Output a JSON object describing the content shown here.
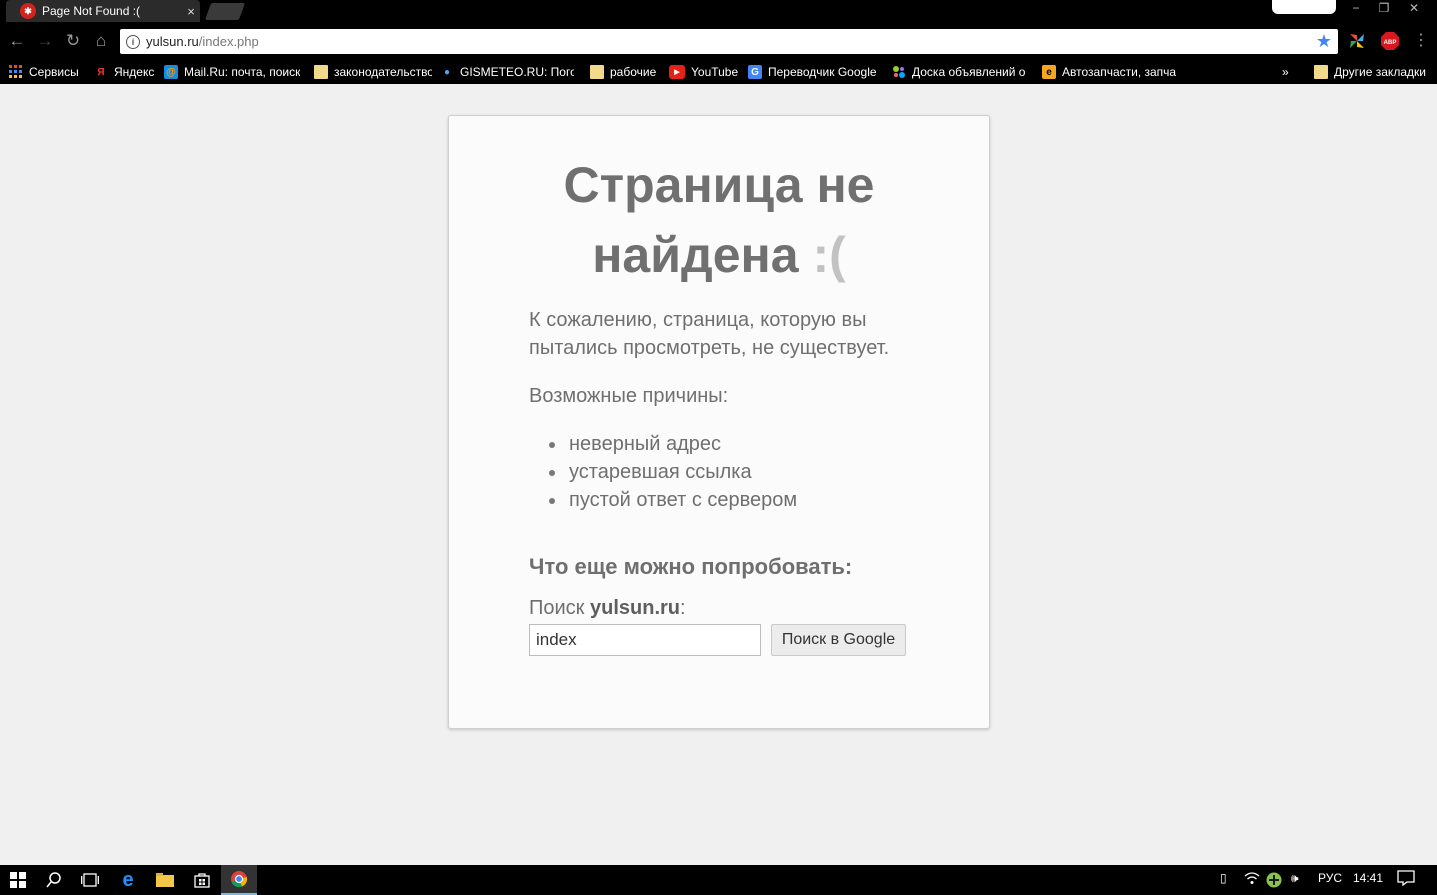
{
  "browser": {
    "tab_title": "Page Not Found :(",
    "tab_close": "×",
    "url_host": "yulsun.ru",
    "url_path": "/index.php",
    "accent": "#4285f4",
    "window_controls": [
      "−",
      "❐",
      "✕"
    ]
  },
  "bookmarks": {
    "items": [
      {
        "label": "Сервисы",
        "icon": "apps-grid-icon"
      },
      {
        "label": "Яндекс",
        "icon": "yandex-icon"
      },
      {
        "label": "Mail.Ru: почта, поиск",
        "icon": "mailru-icon"
      },
      {
        "label": "законодательство",
        "icon": "folder-icon"
      },
      {
        "label": "GISMETEO.RU: Погод",
        "icon": "gismeteo-icon"
      },
      {
        "label": "рабочие",
        "icon": "folder-icon"
      },
      {
        "label": "YouTube",
        "icon": "youtube-icon"
      },
      {
        "label": "Переводчик Google",
        "icon": "translate-icon"
      },
      {
        "label": "Доска объявлений о",
        "icon": "avito-icon"
      },
      {
        "label": "Автозапчасти, запча",
        "icon": "exist-icon"
      }
    ],
    "overflow": "»",
    "other": "Другие закладки"
  },
  "page": {
    "heading_line1": "Страница не",
    "heading_line2": "найдена",
    "heading_face": ":(",
    "intro": "К сожалению, страница, которую вы пытались просмотреть, не существует.",
    "reasons_title": "Возможные причины:",
    "reasons": [
      "неверный адрес",
      "устаревшая ссылка",
      "пустой ответ с сервером"
    ],
    "try_title": "Что еще можно попробовать:",
    "search_prefix": "Поиск ",
    "search_site": "yulsun.ru",
    "search_suffix": ":",
    "search_value": "index",
    "search_button": "Поиск в Google"
  },
  "taskbar": {
    "language": "РУС",
    "time": "14:41"
  }
}
